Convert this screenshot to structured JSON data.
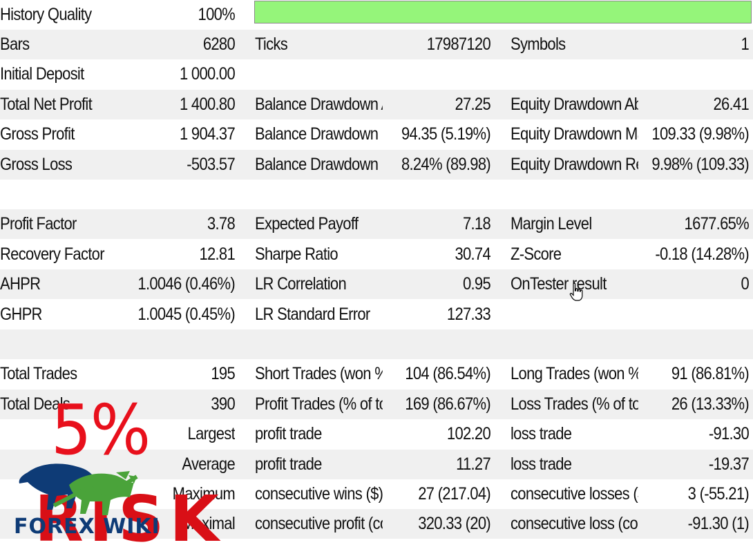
{
  "history_quality": {
    "label": "History Quality",
    "value": "100%",
    "fraction": 1.0
  },
  "colors": {
    "quality_fill": "#95f57a",
    "row_stripe": "#f0f0f0",
    "overlay_red": "#e8101c",
    "logo_blue": "#0e3b76",
    "logo_green": "#4aa33a"
  },
  "rows": [
    {
      "alt": true,
      "cells": [
        "Bars",
        "6280",
        "Ticks",
        "17987120",
        "Symbols",
        "1"
      ]
    },
    {
      "alt": false,
      "cells": [
        "Initial Deposit",
        "1 000.00",
        "",
        "",
        "",
        ""
      ]
    },
    {
      "alt": true,
      "cells": [
        "Total Net Profit",
        "1 400.80",
        "Balance Drawdown A...",
        "27.25",
        "Equity Drawdown Ab...",
        "26.41"
      ]
    },
    {
      "alt": false,
      "cells": [
        "Gross Profit",
        "1 904.37",
        "Balance Drawdown M...",
        "94.35 (5.19%)",
        "Equity Drawdown Ma...",
        "109.33 (9.98%)"
      ]
    },
    {
      "alt": true,
      "cells": [
        "Gross Loss",
        "-503.57",
        "Balance Drawdown R...",
        "8.24% (89.98)",
        "Equity Drawdown Rel...",
        "9.98% (109.33)"
      ]
    },
    {
      "alt": false,
      "cells": [
        "",
        "",
        "",
        "",
        "",
        ""
      ]
    },
    {
      "alt": true,
      "cells": [
        "Profit Factor",
        "3.78",
        "Expected Payoff",
        "7.18",
        "Margin Level",
        "1677.65%"
      ]
    },
    {
      "alt": false,
      "cells": [
        "Recovery Factor",
        "12.81",
        "Sharpe Ratio",
        "30.74",
        "Z-Score",
        "-0.18 (14.28%)"
      ]
    },
    {
      "alt": true,
      "cells": [
        "AHPR",
        "1.0046 (0.46%)",
        "LR Correlation",
        "0.95",
        "OnTester result",
        "0"
      ]
    },
    {
      "alt": false,
      "cells": [
        "GHPR",
        "1.0045 (0.45%)",
        "LR Standard Error",
        "127.33",
        "",
        ""
      ]
    },
    {
      "alt": true,
      "cells": [
        "",
        "",
        "",
        "",
        "",
        ""
      ]
    },
    {
      "alt": false,
      "cells": [
        "Total Trades",
        "195",
        "Short Trades (won %)",
        "104 (86.54%)",
        "Long Trades (won %)",
        "91 (86.81%)"
      ]
    },
    {
      "alt": true,
      "cells": [
        "Total Deals",
        "390",
        "Profit Trades (% of tot...",
        "169 (86.67%)",
        "Loss Trades (% of total)",
        "26 (13.33%)"
      ]
    },
    {
      "alt": false,
      "cells": [
        "",
        "Largest",
        "profit trade",
        "102.20",
        "loss trade",
        "-91.30"
      ]
    },
    {
      "alt": true,
      "cells": [
        "",
        "Average",
        "profit trade",
        "11.27",
        "loss trade",
        "-19.37"
      ]
    },
    {
      "alt": false,
      "cells": [
        "",
        "Maximum",
        "consecutive wins ($)",
        "27 (217.04)",
        "consecutive losses ($)",
        "3 (-55.21)"
      ]
    },
    {
      "alt": true,
      "cells": [
        "",
        "Maximal",
        "consecutive profit (co...",
        "320.33 (20)",
        "consecutive loss (cou...",
        "-91.30 (1)"
      ]
    }
  ],
  "overlay": {
    "percent_text": "5%",
    "risk_text": "RISK",
    "logo_text": "FOREX WIKI"
  }
}
